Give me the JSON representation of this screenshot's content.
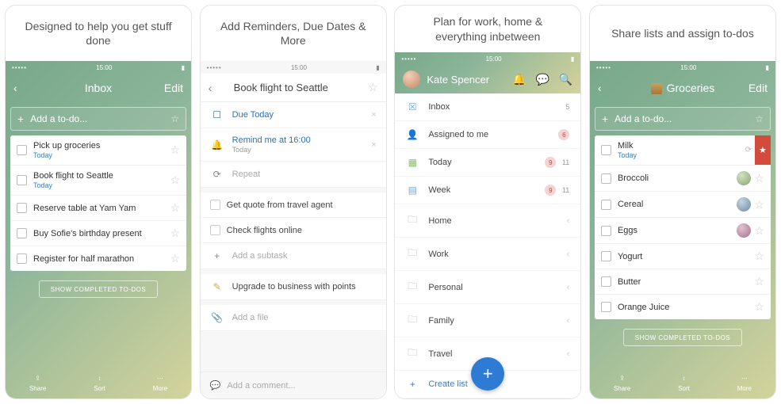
{
  "status_time": "15:00",
  "captions": [
    "Designed to help you get stuff done",
    "Add Reminders, Due Dates & More",
    "Plan for work, home & everything inbetween",
    "Share lists and assign to-dos"
  ],
  "s1": {
    "title": "Inbox",
    "edit": "Edit",
    "add_placeholder": "Add a to-do...",
    "todos": [
      {
        "t": "Pick up groceries",
        "sub": "Today"
      },
      {
        "t": "Book flight to Seattle",
        "sub": "Today"
      },
      {
        "t": "Reserve table at Yam Yam"
      },
      {
        "t": "Buy Sofie's birthday present"
      },
      {
        "t": "Register for half marathon"
      }
    ],
    "show_completed": "SHOW COMPLETED TO-DOS",
    "bottom": {
      "share": "Share",
      "sort": "Sort",
      "more": "More"
    }
  },
  "s2": {
    "title": "Book flight to Seattle",
    "due": {
      "label": "Due Today"
    },
    "remind": {
      "label": "Remind me at 16:00",
      "sub": "Today"
    },
    "repeat": "Repeat",
    "subtasks": [
      "Get quote from travel agent",
      "Check flights online"
    ],
    "add_subtask": "Add a subtask",
    "note": "Upgrade to business with points",
    "add_file": "Add a file",
    "add_comment": "Add a comment..."
  },
  "s3": {
    "user": "Kate Spencer",
    "items": [
      {
        "icon": "📥",
        "label": "Inbox",
        "count": "5"
      },
      {
        "icon": "👤",
        "label": "Assigned to me",
        "red": "6"
      },
      {
        "icon": "📅",
        "label": "Today",
        "red": "9",
        "count": "11"
      },
      {
        "icon": "🗓",
        "label": "Week",
        "red": "9",
        "count": "11"
      }
    ],
    "folders": [
      "Home",
      "Work",
      "Personal",
      "Family",
      "Travel"
    ],
    "create": "Create list"
  },
  "s4": {
    "title": "Groceries",
    "edit": "Edit",
    "add_placeholder": "Add a to-do...",
    "items": [
      {
        "t": "Milk",
        "sub": "Today",
        "assign": "repeat",
        "starred": true
      },
      {
        "t": "Broccoli",
        "av": "green"
      },
      {
        "t": "Cereal",
        "av": "blue"
      },
      {
        "t": "Eggs",
        "av": "pink"
      },
      {
        "t": "Yogurt"
      },
      {
        "t": "Butter"
      },
      {
        "t": "Orange Juice"
      }
    ],
    "show_completed": "SHOW COMPLETED TO-DOS",
    "bottom": {
      "share": "Share",
      "sort": "Sort",
      "more": "More"
    }
  }
}
